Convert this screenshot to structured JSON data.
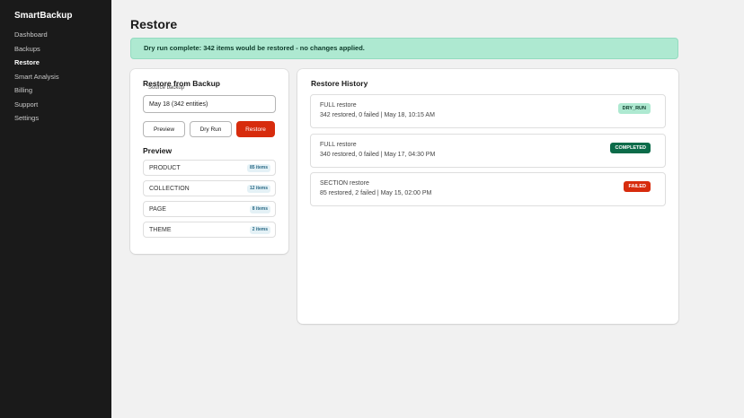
{
  "sidebar": {
    "brand": "SmartBackup",
    "items": [
      {
        "label": "Dashboard"
      },
      {
        "label": "Backups"
      },
      {
        "label": "Restore"
      },
      {
        "label": "Smart Analysis"
      },
      {
        "label": "Billing"
      },
      {
        "label": "Support"
      },
      {
        "label": "Settings"
      }
    ],
    "active": "Restore"
  },
  "page": {
    "title": "Restore",
    "banner": "Dry run complete: 342 items would be restored - no changes applied."
  },
  "restore_form": {
    "title": "Restore from Backup",
    "source_label": "Source backup",
    "source_value": "May 18 (342 entities)",
    "buttons": {
      "preview": "Preview",
      "dry_run": "Dry Run",
      "restore": "Restore"
    },
    "preview_title": "Preview",
    "preview_rows": [
      {
        "label": "PRODUCT",
        "count": "85 items"
      },
      {
        "label": "COLLECTION",
        "count": "12 items"
      },
      {
        "label": "PAGE",
        "count": "8 items"
      },
      {
        "label": "THEME",
        "count": "2 items"
      }
    ]
  },
  "history": {
    "title": "Restore History",
    "items": [
      {
        "type": "FULL restore",
        "details": "342 restored, 0 failed | May 18, 10:15 AM",
        "status": "DRY_RUN"
      },
      {
        "type": "FULL restore",
        "details": "340 restored, 0 failed | May 17, 04:30 PM",
        "status": "COMPLETED"
      },
      {
        "type": "SECTION restore",
        "details": "85 restored, 2 failed | May 15, 02:00 PM",
        "status": "FAILED"
      }
    ]
  },
  "colors": {
    "sidebar_bg": "#1a1a1a",
    "banner_bg": "#aee9d1",
    "primary_button": "#d72c0d",
    "status_dry_run": "#aee9d1",
    "status_completed": "#0b6b49",
    "status_failed": "#d72c0d"
  }
}
